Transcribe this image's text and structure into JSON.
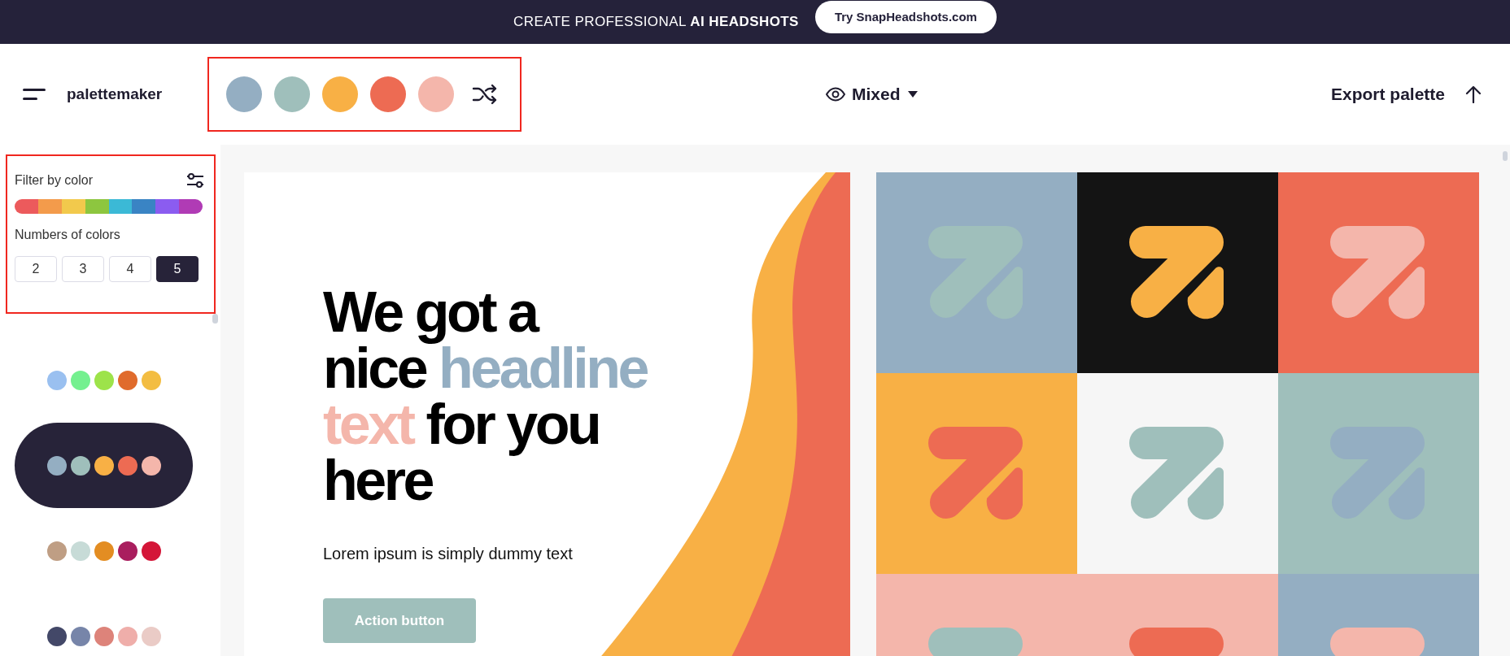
{
  "banner": {
    "text": "CREATE PROFESSIONAL **AI HEADSHOTS**",
    "button": "Try SnapHeadshots.com"
  },
  "header": {
    "logo": "palettemaker",
    "swatches": [
      {
        "color": "#94aec2"
      },
      {
        "color": "#9fbfbb"
      },
      {
        "color": "#f8b045"
      },
      {
        "color": "#ed6b53"
      },
      {
        "color": "#f4b6ab"
      }
    ],
    "view_mode": "Mixed",
    "export": "Export palette"
  },
  "filter": {
    "title": "Filter by color",
    "hues": [
      {
        "color": "#ec5a5c"
      },
      {
        "color": "#f39b4b"
      },
      {
        "color": "#f2c94c"
      },
      {
        "color": "#8dc63f"
      },
      {
        "color": "#3bb9d6"
      },
      {
        "color": "#3a84c4"
      },
      {
        "color": "#8b5cf0"
      },
      {
        "color": "#b03bb5"
      }
    ],
    "count_label": "Numbers of colors",
    "counts": [
      {
        "label": "2",
        "selected": false
      },
      {
        "label": "3",
        "selected": false
      },
      {
        "label": "4",
        "selected": false
      },
      {
        "label": "5",
        "selected": true
      }
    ]
  },
  "palettes": [
    {
      "selected": false,
      "colors": [
        {
          "color": "#9ac0f0"
        },
        {
          "color": "#74f08f"
        },
        {
          "color": "#9de34a"
        },
        {
          "color": "#e06b2c"
        },
        {
          "color": "#f3bd42"
        }
      ]
    },
    {
      "selected": true,
      "colors": [
        {
          "color": "#94aec2"
        },
        {
          "color": "#9fbfbb"
        },
        {
          "color": "#f8b045"
        },
        {
          "color": "#ed6b53"
        },
        {
          "color": "#f4b6ab"
        }
      ]
    },
    {
      "selected": false,
      "colors": [
        {
          "color": "#bf9e84"
        },
        {
          "color": "#c7dbd7"
        },
        {
          "color": "#e38d22"
        },
        {
          "color": "#a91e5e"
        },
        {
          "color": "#d41638"
        }
      ]
    },
    {
      "selected": false,
      "colors": [
        {
          "color": "#434868"
        },
        {
          "color": "#7785a9"
        },
        {
          "color": "#dd837a"
        },
        {
          "color": "#efaeaa"
        },
        {
          "color": "#eacbc6"
        }
      ]
    }
  ],
  "preview": {
    "headline_lines": [
      [
        {
          "text": "We got a",
          "color": "#000000"
        }
      ],
      [
        {
          "text": "nice",
          "color": "#000000"
        },
        {
          "text": "headline",
          "color": "#94aec2"
        }
      ],
      [
        {
          "text": "text",
          "color": "#f4b6ab"
        },
        {
          "text": "for you",
          "color": "#000000"
        }
      ],
      [
        {
          "text": "here",
          "color": "#000000"
        }
      ]
    ],
    "body": "Lorem ipsum is simply dummy text",
    "button": {
      "label": "Action button",
      "color": "#9fbfbb"
    }
  },
  "tiles": [
    {
      "color": "#94aec2",
      "logo": {
        "color": "#9fbfbb"
      }
    },
    {
      "color": "#141414",
      "logo": {
        "color": "#f8b045"
      }
    },
    {
      "color": "#ed6b53",
      "logo": {
        "color": "#f4b6ab"
      }
    },
    {
      "color": "#f8b045",
      "logo": {
        "color": "#ed6b53"
      }
    },
    {
      "color": "#f6f6f6",
      "logo": {
        "color": "#9fbfbb"
      }
    },
    {
      "color": "#9fbfbb",
      "logo": {
        "color": "#94aec2"
      }
    },
    {
      "color": "#f4b6ab",
      "logo": {
        "color": "#9fbfbb"
      }
    },
    {
      "color": "#f4b6ab",
      "logo": {
        "color": "#ed6b53"
      }
    },
    {
      "color": "#94aec2",
      "logo": {
        "color": "#f4b6ab"
      }
    }
  ]
}
